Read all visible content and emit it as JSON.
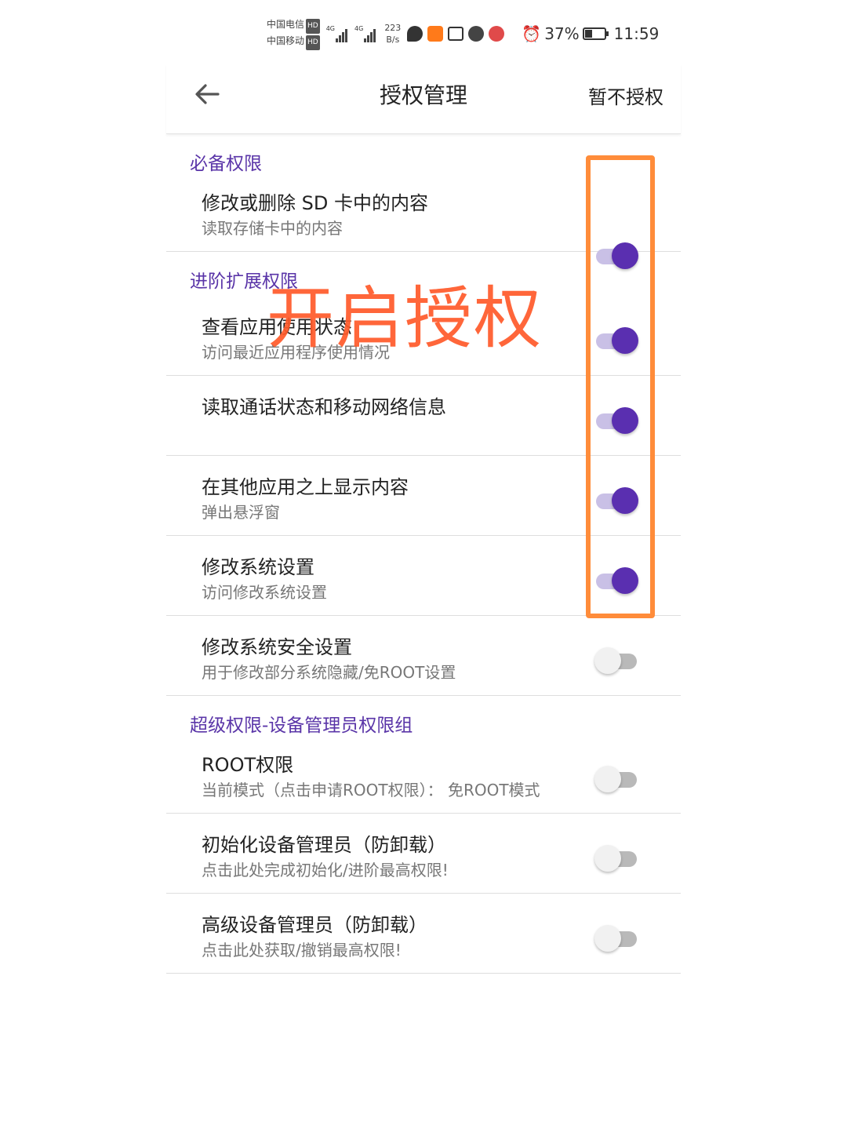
{
  "status_bar": {
    "carrier_1": "中国电信",
    "carrier_2": "中国移动",
    "hd_badge": "HD",
    "network_1": "4G",
    "network_2": "4G",
    "speed_value": "223",
    "speed_unit": "B/s",
    "battery": "37%",
    "battery_level": 0.37,
    "time": "11:59"
  },
  "app_bar": {
    "title": "授权管理",
    "action": "暂不授权"
  },
  "sections": [
    {
      "header": "必备权限",
      "items": [
        {
          "title": "修改或删除 SD 卡中的内容",
          "subtitle": "读取存储卡中的内容",
          "enabled": true
        }
      ]
    },
    {
      "header": "进阶扩展权限",
      "items": [
        {
          "title": "查看应用使用状态",
          "subtitle": "访问最近应用程序使用情况",
          "enabled": true
        },
        {
          "title": "读取通话状态和移动网络信息",
          "subtitle": "",
          "enabled": true
        },
        {
          "title": "在其他应用之上显示内容",
          "subtitle": "弹出悬浮窗",
          "enabled": true
        },
        {
          "title": "修改系统设置",
          "subtitle": "访问修改系统设置",
          "enabled": true
        },
        {
          "title": "修改系统安全设置",
          "subtitle": "用于修改部分系统隐藏/免ROOT设置",
          "enabled": false
        }
      ]
    },
    {
      "header": "超级权限-设备管理员权限组",
      "items": [
        {
          "title": "ROOT权限",
          "subtitle": "当前模式（点击申请ROOT权限）： 免ROOT模式",
          "enabled": false
        },
        {
          "title": "初始化设备管理员（防卸载）",
          "subtitle": "点击此处完成初始化/进阶最高权限!",
          "enabled": false
        },
        {
          "title": "高级设备管理员（防卸载）",
          "subtitle": "点击此处获取/撤销最高权限!",
          "enabled": false
        }
      ]
    }
  ],
  "annotation": {
    "text": "开启授权",
    "color": "#ff5a2a",
    "box_color": "#ff8c3a"
  },
  "colors": {
    "accent": "#5a35a8",
    "toggle_on": "#5a2fb0"
  }
}
